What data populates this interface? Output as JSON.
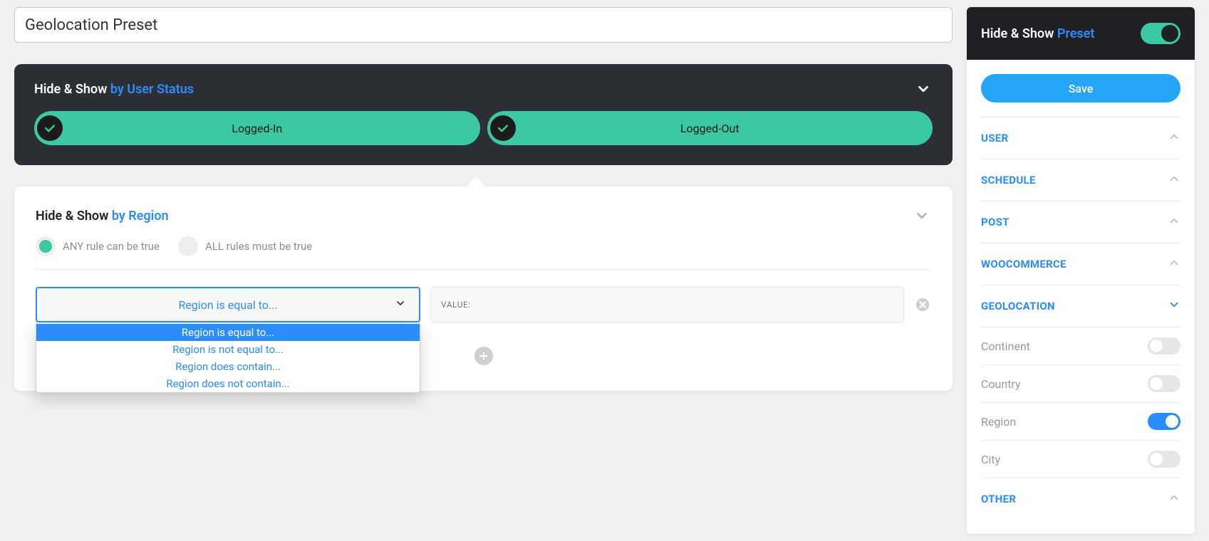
{
  "titleInput": {
    "value": "Geolocation Preset"
  },
  "userStatusPanel": {
    "prefix": "Hide & Show ",
    "suffix": "by User Status",
    "options": [
      "Logged-In",
      "Logged-Out"
    ]
  },
  "regionPanel": {
    "prefix": "Hide & Show ",
    "suffix": "by Region",
    "ruleModes": {
      "any": "ANY rule can be true",
      "all": "ALL rules must be true"
    },
    "selectedRule": "Region is equal to...",
    "dropdownOptions": [
      "Region is equal to...",
      "Region is not equal to...",
      "Region does contain...",
      "Region does not contain..."
    ],
    "valuePlaceholder": "VALUE:"
  },
  "sidebar": {
    "headerPrefix": "Hide & Show ",
    "headerSuffix": "Preset",
    "saveLabel": "Save",
    "sections": {
      "user": "USER",
      "schedule": "SCHEDULE",
      "post": "POST",
      "woocommerce": "WOOCOMMERCE",
      "geolocation": "GEOLOCATION",
      "other": "OTHER"
    },
    "geoItems": {
      "continent": "Continent",
      "country": "Country",
      "region": "Region",
      "city": "City"
    }
  }
}
